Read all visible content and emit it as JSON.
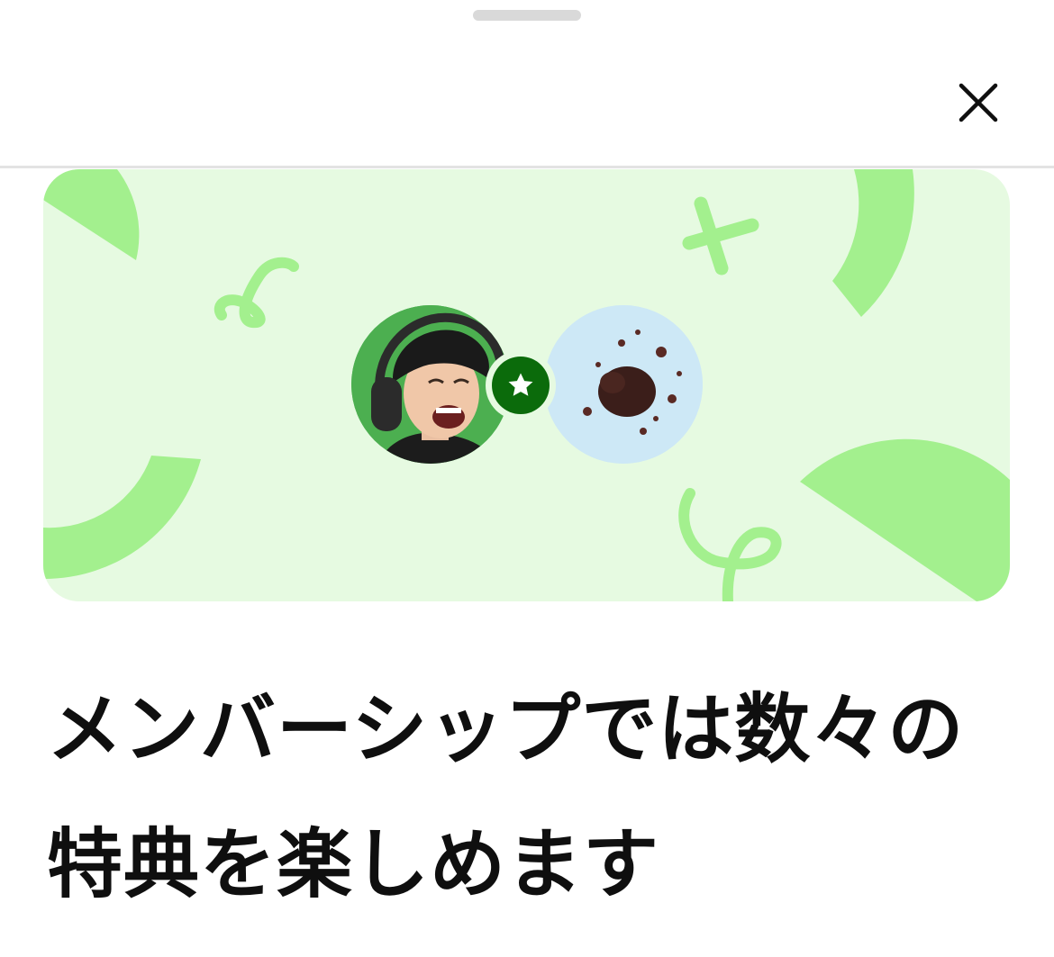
{
  "sheet": {
    "headline": "メンバーシップでは数々の特典を楽しめます"
  },
  "icons": {
    "close": "close-icon",
    "star": "star-icon",
    "drag_handle": "drag-handle"
  },
  "colors": {
    "banner_background": "#e6fae1",
    "banner_shapes": "#a3f08e",
    "star_badge": "#0b6b0b",
    "headline_text": "#0f0f0f"
  }
}
